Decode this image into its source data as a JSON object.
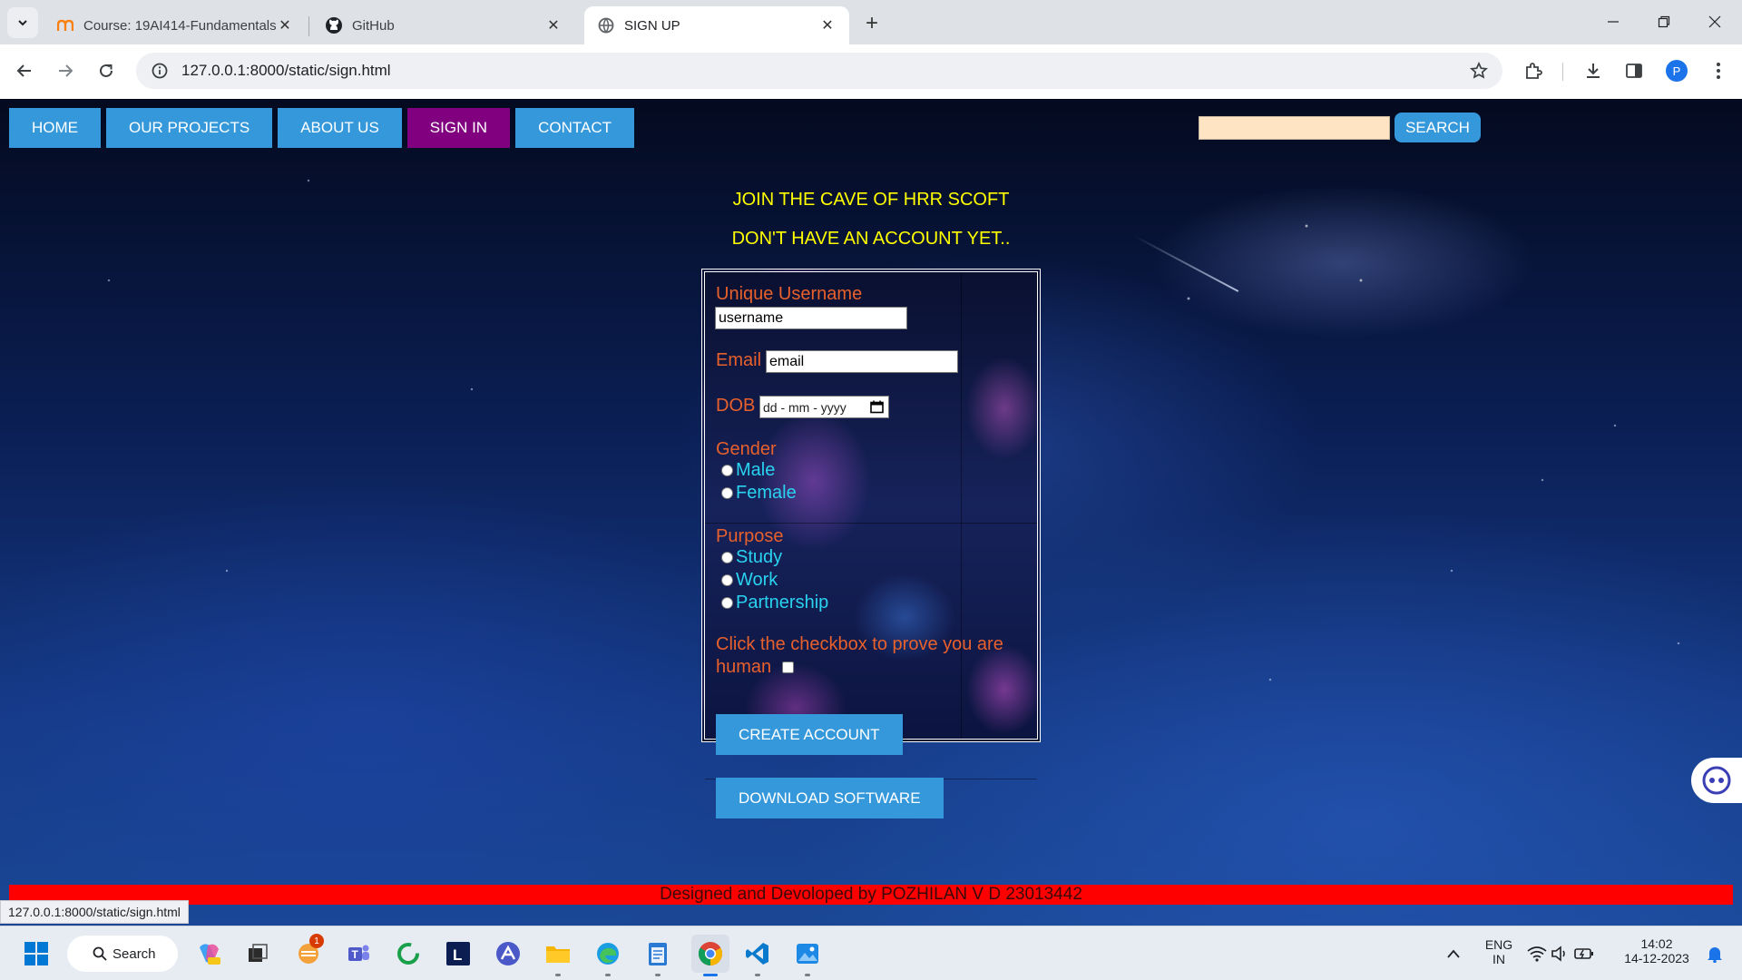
{
  "browser": {
    "tabs": [
      {
        "title": "Course: 19AI414-Fundamentals",
        "favicon": "moodle-icon"
      },
      {
        "title": "GitHub",
        "favicon": "github-icon"
      },
      {
        "title": "SIGN UP",
        "favicon": "globe-icon"
      }
    ],
    "url": "127.0.0.1:8000/static/sign.html",
    "profile_initial": "P",
    "status_url": "127.0.0.1:8000/static/sign.html"
  },
  "page": {
    "nav": [
      "HOME",
      "OUR PROJECTS",
      "ABOUT US",
      "SIGN IN",
      "CONTACT"
    ],
    "active_nav": "SIGN IN",
    "search_button": "SEARCH",
    "search_value": "",
    "heading1": "JOIN THE CAVE OF HRR SCOFT",
    "heading2": "DON'T HAVE AN ACCOUNT YET..",
    "form": {
      "username_label": "Unique Username",
      "username_value": "username",
      "email_label": "Email",
      "email_value": "email",
      "dob_label": "DOB",
      "dob_value": "dd - mm - yyyy",
      "gender_label": "Gender",
      "gender_options": [
        "Male",
        "Female"
      ],
      "purpose_label": "Purpose",
      "purpose_options": [
        "Study",
        "Work",
        "Partnership"
      ],
      "human_label_line1": "Click the checkbox to prove you are",
      "human_label_line2": "human",
      "create_button": "CREATE ACCOUNT",
      "download_button": "DOWNLOAD SOFTWARE"
    },
    "footer": "Designed and Devoloped by POZHILAN V D 23013442"
  },
  "taskbar": {
    "search_label": "Search",
    "language_line1": "ENG",
    "language_line2": "IN",
    "time": "14:02",
    "date": "14-12-2023",
    "mail_badge": "1",
    "pinned": [
      "copilot-icon",
      "task-view-icon",
      "mail-icon",
      "teams-icon",
      "circle-app-icon",
      "l-app-icon",
      "triangle-app-icon",
      "file-explorer-icon",
      "edge-icon",
      "notepad-icon",
      "chrome-icon",
      "vscode-icon",
      "photos-icon"
    ]
  }
}
